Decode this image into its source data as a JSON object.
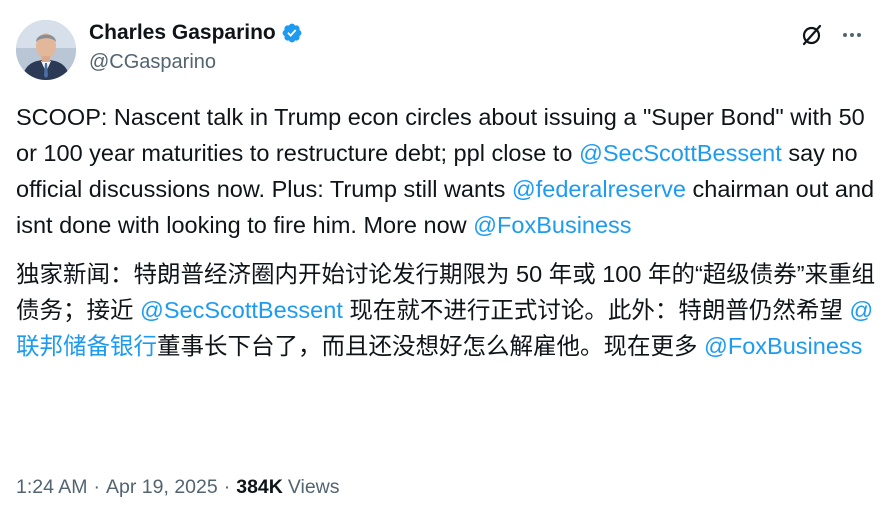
{
  "author": {
    "display_name": "Charles Gasparino",
    "handle": "@CGasparino",
    "verified": true
  },
  "tweet": {
    "en": [
      {
        "t": "text",
        "v": "SCOOP: Nascent talk in Trump econ circles about issuing a \"Super Bond\" with 50 or 100 year maturities to restructure debt; ppl close to "
      },
      {
        "t": "link",
        "v": "@SecScottBessent"
      },
      {
        "t": "text",
        "v": " say no official discussions now. Plus: Trump still wants "
      },
      {
        "t": "link",
        "v": "@federalreserve"
      },
      {
        "t": "text",
        "v": " chairman out and isnt done with looking to fire him. More now "
      },
      {
        "t": "link",
        "v": "@FoxBusiness"
      }
    ],
    "zh": [
      {
        "t": "text",
        "v": "独家新闻：特朗普经济圈内开始讨论发行期限为 50 年或 100 年的“超级债券”来重组债务；接近 "
      },
      {
        "t": "link",
        "v": "@SecScottBessent"
      },
      {
        "t": "text",
        "v": " 现在就不进行正式讨论。此外：特朗普仍然希望 "
      },
      {
        "t": "link",
        "v": "@联邦储备银行"
      },
      {
        "t": "text",
        "v": "董事长下台了，而且还没想好怎么解雇他。现在更多 "
      },
      {
        "t": "link",
        "v": "@FoxBusiness"
      }
    ]
  },
  "meta": {
    "time": "1:24 AM",
    "separator": "·",
    "date": "Apr 19, 2025",
    "views_count": "384K",
    "views_label": "Views"
  },
  "icons": {
    "verified": "verified-badge-icon",
    "grok": "grok-icon",
    "more": "more-icon"
  },
  "colors": {
    "link": "#1d9bf0",
    "secondary_text": "#536471",
    "primary_text": "#0f1419",
    "verified": "#1d9bf0"
  }
}
